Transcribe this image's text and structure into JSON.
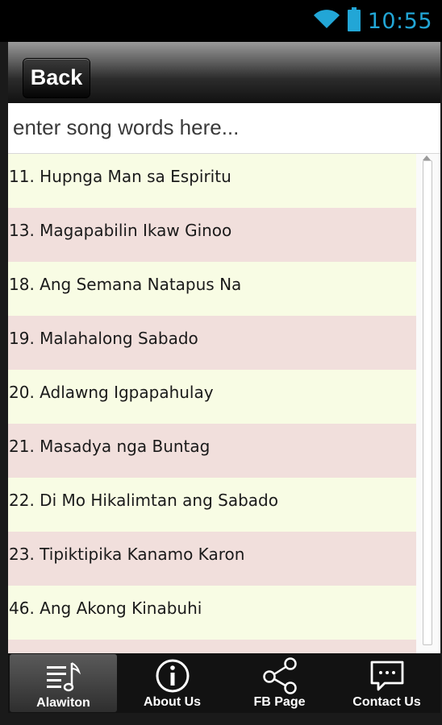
{
  "status_bar": {
    "time": "10:55",
    "icons": [
      "wifi-icon",
      "battery-icon"
    ],
    "accent_color": "#22a6d6"
  },
  "header": {
    "back_label": "Back"
  },
  "search": {
    "placeholder": "enter song words here..."
  },
  "songs": [
    "11. Hupnga Man sa Espiritu",
    "13. Magapabilin Ikaw Ginoo",
    "18. Ang Semana Natapus Na",
    "19. Malahalong Sabado",
    "20. Adlawng Igpapahulay",
    "21. Masadya nga Buntag",
    "22. Di Mo Hikalimtan ang Sabado",
    "23. Tipiktipika Kanamo Karon",
    "46. Ang Akong Kinabuhi"
  ],
  "colors": {
    "row_odd": "#f8fce4",
    "row_even": "#f1dfdc"
  },
  "tabs": [
    {
      "label": "Alawiton",
      "icon": "music-list-icon",
      "active": true
    },
    {
      "label": "About Us",
      "icon": "info-icon",
      "active": false
    },
    {
      "label": "FB Page",
      "icon": "share-icon",
      "active": false
    },
    {
      "label": "Contact Us",
      "icon": "chat-bubble-icon",
      "active": false
    }
  ]
}
